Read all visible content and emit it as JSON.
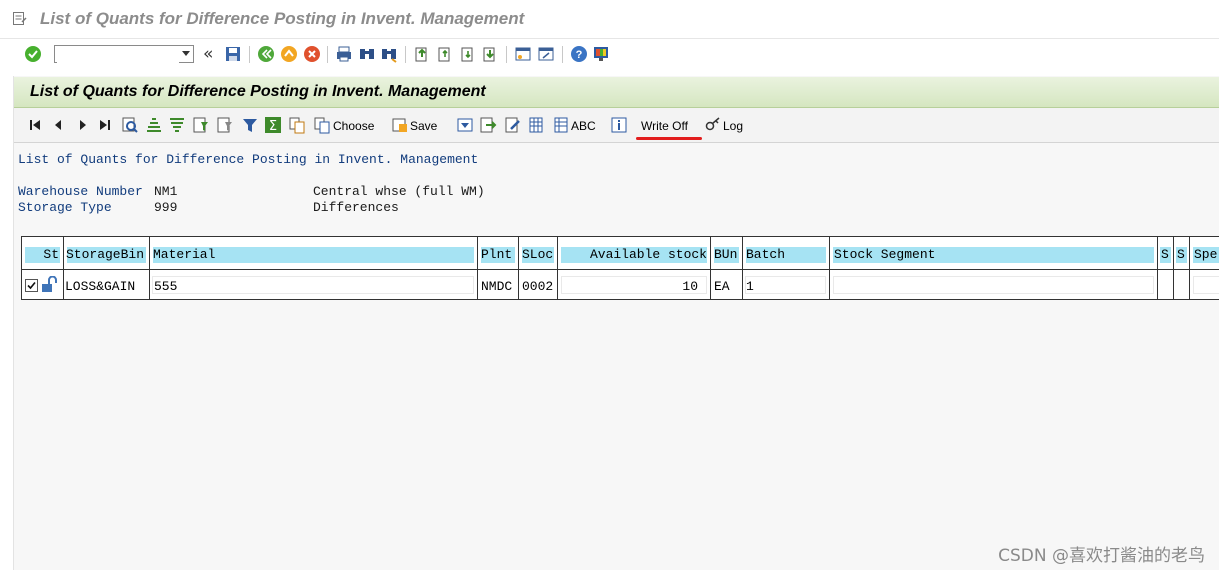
{
  "window": {
    "title": "List of Quants for Difference Posting in Invent. Management"
  },
  "system_toolbar": {
    "command_field_value": "",
    "icons": [
      "enter-icon",
      "save-icon",
      "back-icon",
      "exit-icon",
      "cancel-icon",
      "print-icon",
      "find-icon",
      "find-next-icon",
      "first-page-icon",
      "previous-page-icon",
      "next-page-icon",
      "last-page-icon",
      "create-session-icon",
      "shortcut-icon",
      "help-icon",
      "customize-layout-icon"
    ]
  },
  "header": {
    "title": "List of Quants for Difference Posting in Invent. Management"
  },
  "app_toolbar": {
    "choose_label": "Choose",
    "save_label": "Save",
    "abc_label": "ABC",
    "write_off_label": "Write Off",
    "log_label": "Log"
  },
  "report": {
    "heading": "List of Quants for Difference Posting in Invent. Management",
    "warehouse_label": "Warehouse Number",
    "warehouse_value": "NM1",
    "warehouse_desc": "Central whse (full WM)",
    "storage_type_label": "Storage Type",
    "storage_type_value": "999",
    "storage_type_desc": "Differences"
  },
  "grid": {
    "columns": [
      "St",
      "StorageBin",
      "Material",
      "Plnt",
      "SLoc",
      "Available stock",
      "BUn",
      "Batch",
      "Stock Segment",
      "S",
      "S",
      "Spe"
    ],
    "rows": [
      {
        "checked": true,
        "storage_bin": "LOSS&GAIN",
        "material": "555",
        "plant": "NMDC",
        "sloc": "0002",
        "available_stock": "10",
        "bun": "EA",
        "batch": "1",
        "stock_segment": ""
      }
    ]
  },
  "watermark": "CSDN @喜欢打酱油的老鸟",
  "colors": {
    "header_green": "#d5e6c0",
    "column_header_blue": "#a6e3f3",
    "text_blue": "#123c7d",
    "annotation_red": "#e21d1d"
  }
}
